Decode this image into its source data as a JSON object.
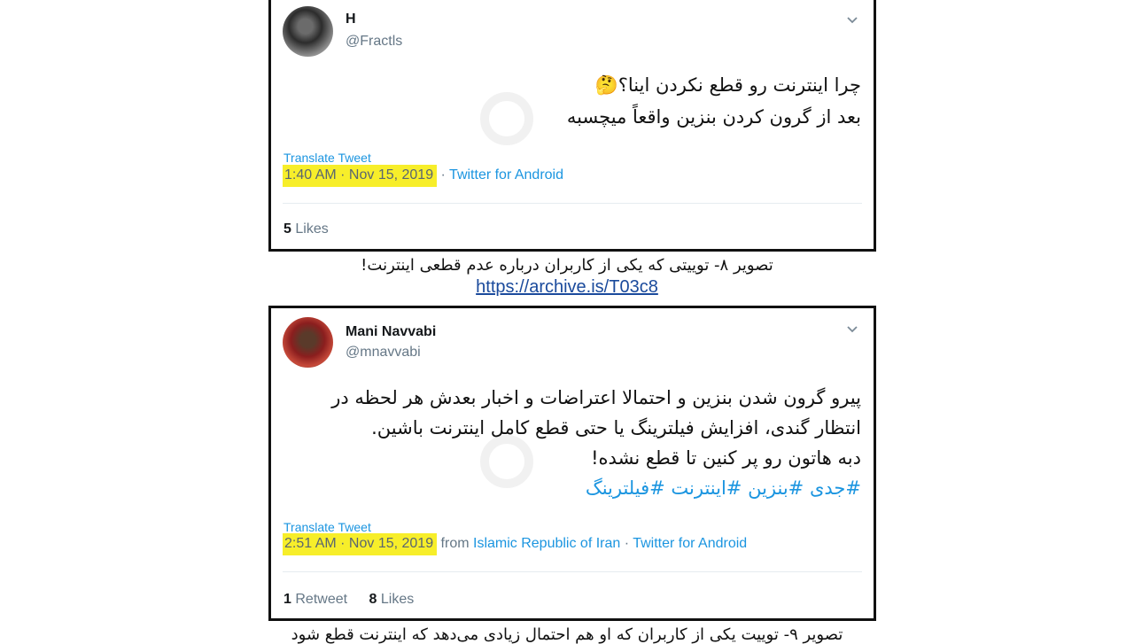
{
  "tweet1": {
    "name": "H",
    "handle": "@Fractls",
    "text_line1": "چرا اینترنت رو قطع نکردن اینا؟🤔",
    "text_line2": "بعد از گرون کردن بنزین واقعاً میچسبه",
    "translate": "Translate Tweet",
    "time": "1:40 AM · Nov 15, 2019",
    "separator": " · ",
    "source": "Twitter for Android",
    "likes_count": "5",
    "likes_label": "Likes"
  },
  "caption1": "تصویر ۸- توییتی که یکی از کاربران درباره عدم قطعی اینترنت!",
  "caption1_link": "https://archive.is/T03c8",
  "tweet2": {
    "name": "Mani Navvabi",
    "handle": "@mnavvabi",
    "text_line1": "پیرو گرون شدن بنزین و احتمالا اعتراضات و اخبار بعدش هر لحظه در",
    "text_line2": "انتظار گندی، افزایش فیلترینگ یا حتی قطع کامل اینترنت باشین.",
    "text_line3": "دبه هاتون رو پر کنین تا قطع نشده!",
    "hashtags": "#جدی #بنزین #اینترنت #فیلترینگ",
    "translate": "Translate Tweet",
    "time": "2:51 AM · Nov 15, 2019",
    "from_label": " from ",
    "location": "Islamic Republic of Iran",
    "separator": " · ",
    "source": "Twitter for Android",
    "retweets_count": "1",
    "retweets_label": "Retweet",
    "likes_count": "8",
    "likes_label": "Likes"
  },
  "caption2": "تصویر ۹- توییت یکی از کاربران که او هم احتمال زیادی می‌دهد که اینترنت قطع شود",
  "colors": {
    "link": "#1b95e0",
    "highlight": "#f7ee2a",
    "muted": "#657786",
    "border": "#111111"
  },
  "icons": [
    "chevron-down-icon"
  ]
}
